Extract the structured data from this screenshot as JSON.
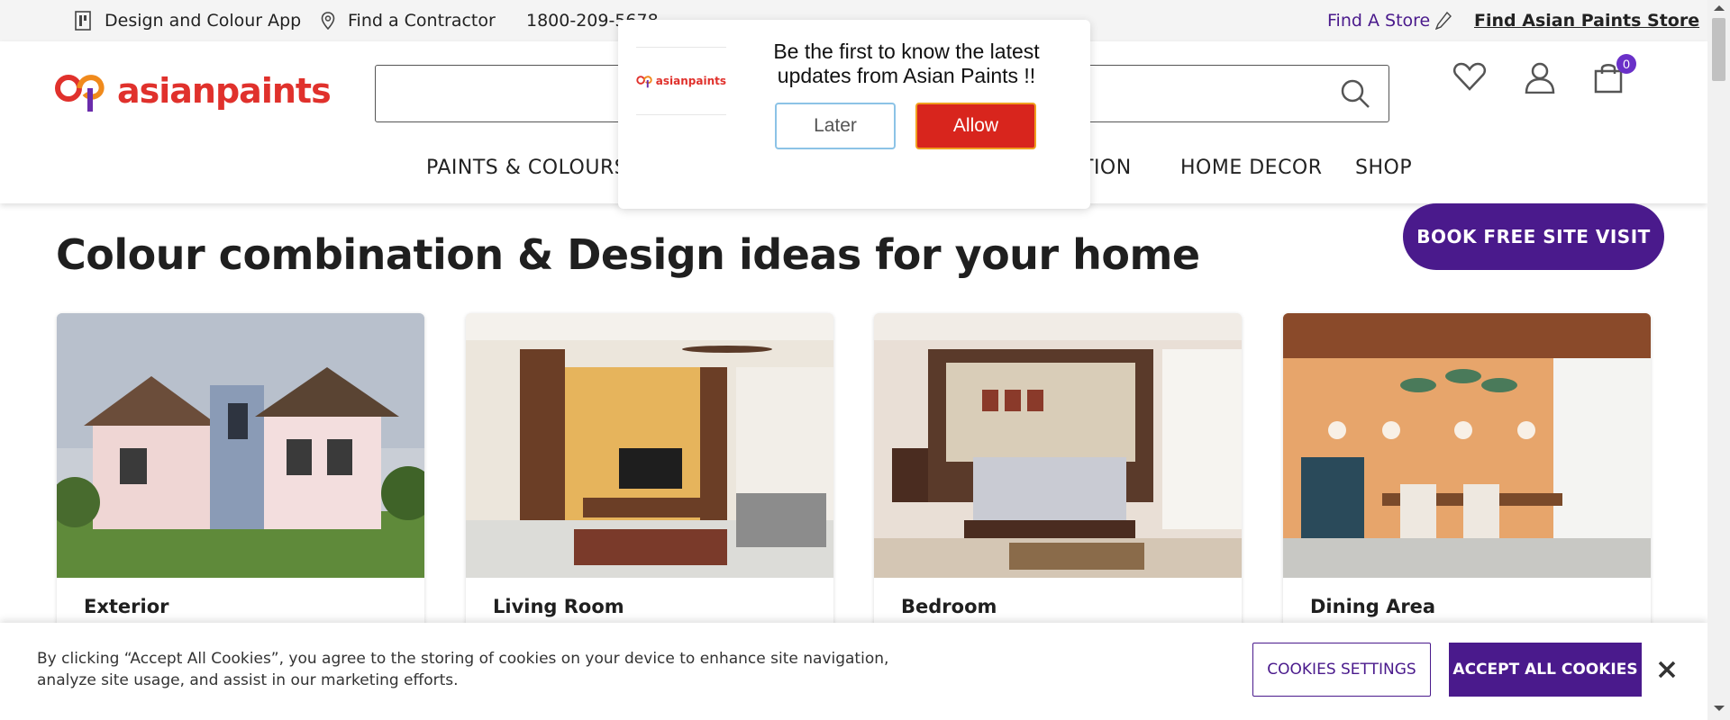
{
  "topbar": {
    "design_app": "Design and Colour App",
    "find_contractor": "Find a Contractor",
    "phone": "1800-209-5678",
    "find_store": "Find A Store",
    "find_asian_paints_store": "Find Asian Paints Store"
  },
  "header": {
    "logo_text": "asianpaints",
    "search": {
      "value": "",
      "placeholder": ""
    },
    "cart_count": "0",
    "nav": [
      "PAINTS & COLOURS",
      "HOME DECOR",
      "SHOP"
    ],
    "nav_partial": "TION"
  },
  "main": {
    "title": "Colour combination & Design ideas for your home",
    "book_button": "BOOK FREE SITE VISIT",
    "cards": [
      {
        "label": "Exterior"
      },
      {
        "label": "Living Room"
      },
      {
        "label": "Bedroom"
      },
      {
        "label": "Dining Area"
      }
    ]
  },
  "popup": {
    "logo_text": "asianpaints",
    "message": "Be the first to know the latest updates from Asian Paints !!",
    "later": "Later",
    "allow": "Allow"
  },
  "cookie": {
    "text": "By clicking “Accept All Cookies”, you agree to the storing of cookies on your device to enhance site navigation, analyze site usage, and assist in our marketing efforts.",
    "settings": "COOKIES SETTINGS",
    "accept": "ACCEPT ALL COOKIES"
  },
  "colors": {
    "brand_purple": "#4a1a8c",
    "brand_red": "#e0312c",
    "allow_red": "#d8251d"
  }
}
